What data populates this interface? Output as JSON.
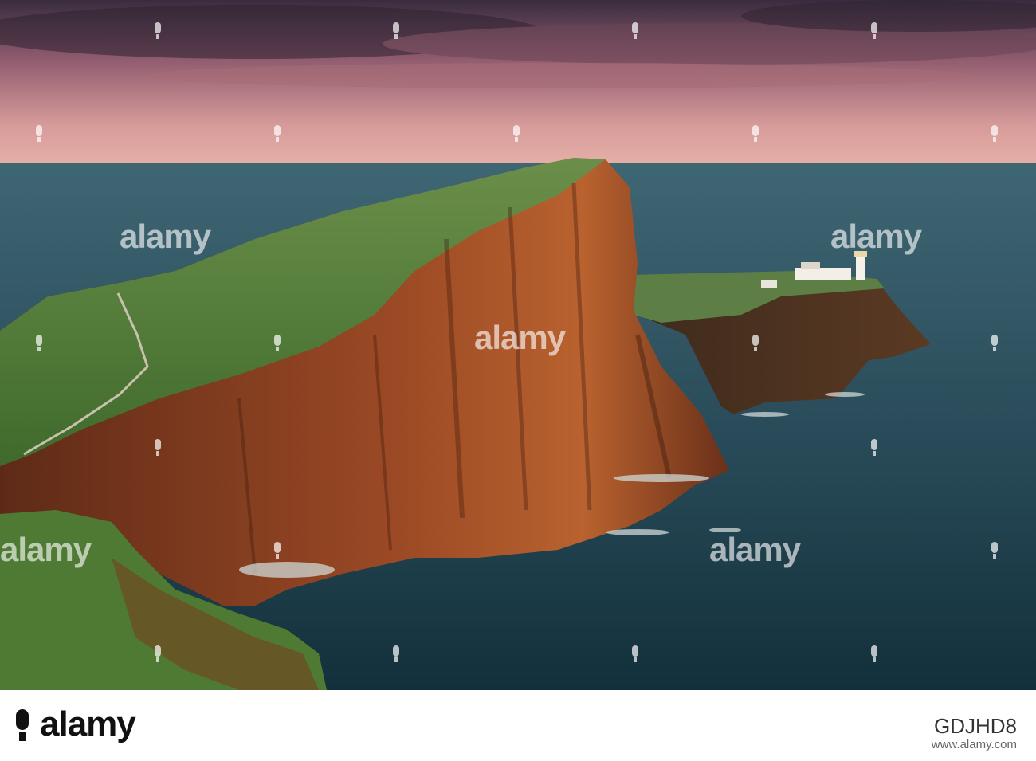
{
  "watermark": {
    "word": "alamy",
    "color": "#ffffff"
  },
  "footer": {
    "brand": "alamy",
    "image_id": "GDJHD8",
    "site": "www.alamy.com"
  },
  "scene": {
    "sky_top": "#3b3040",
    "sky_glow": "#e0a09c",
    "sea": "#234250",
    "cliff": "#8a3f22",
    "grass": "#5c8a3e",
    "lighthouse": "#f3efe6"
  }
}
